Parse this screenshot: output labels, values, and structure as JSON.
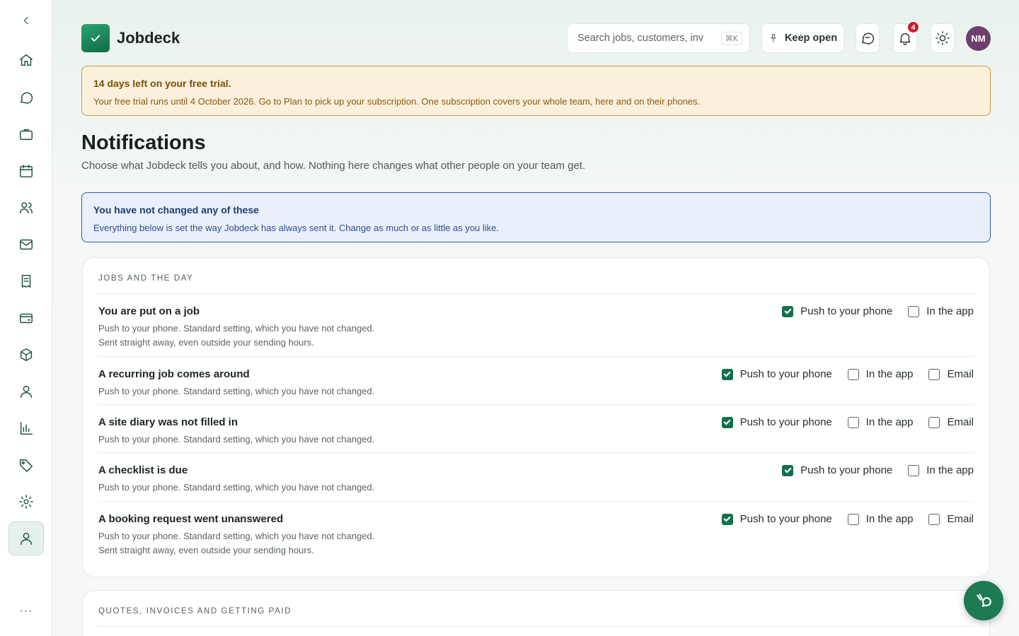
{
  "brand": {
    "name": "Jobdeck"
  },
  "search": {
    "placeholder": "Search jobs, customers, invoices",
    "shortcut": "⌘K"
  },
  "header": {
    "keep_open_label": "Keep open",
    "notification_count": "4",
    "avatar_initials": "NM"
  },
  "trial": {
    "title": "14 days left on your free trial.",
    "text": "Your free trial runs until 4 October 2026. Go to Plan to pick up your subscription. One subscription covers your whole team, here and on their phones."
  },
  "page": {
    "title": "Notifications",
    "subtitle": "Choose what Jobdeck tells you about, and how. Nothing here changes what other people on your team get."
  },
  "info": {
    "title": "You have not changed any of these",
    "text": "Everything below is set the way Jobdeck has always sent it. Change as much or as little as you like."
  },
  "sections": [
    {
      "heading": "JOBS AND THE DAY",
      "rows": [
        {
          "title": "You are put on a job",
          "desc1": "Push to your phone. Standard setting, which you have not changed.",
          "desc2": "Sent straight away, even outside your sending hours.",
          "options": [
            {
              "label": "Push to your phone",
              "checked": true
            },
            {
              "label": "In the app",
              "checked": false
            }
          ]
        },
        {
          "title": "A recurring job comes around",
          "desc1": "Push to your phone. Standard setting, which you have not changed.",
          "options": [
            {
              "label": "Push to your phone",
              "checked": true
            },
            {
              "label": "In the app",
              "checked": false
            },
            {
              "label": "Email",
              "checked": false
            }
          ]
        },
        {
          "title": "A site diary was not filled in",
          "desc1": "Push to your phone. Standard setting, which you have not changed.",
          "options": [
            {
              "label": "Push to your phone",
              "checked": true
            },
            {
              "label": "In the app",
              "checked": false
            },
            {
              "label": "Email",
              "checked": false
            }
          ]
        },
        {
          "title": "A checklist is due",
          "desc1": "Push to your phone. Standard setting, which you have not changed.",
          "options": [
            {
              "label": "Push to your phone",
              "checked": true
            },
            {
              "label": "In the app",
              "checked": false
            }
          ]
        },
        {
          "title": "A booking request went unanswered",
          "desc1": "Push to your phone. Standard setting, which you have not changed.",
          "desc2": "Sent straight away, even outside your sending hours.",
          "options": [
            {
              "label": "Push to your phone",
              "checked": true
            },
            {
              "label": "In the app",
              "checked": false
            },
            {
              "label": "Email",
              "checked": false
            }
          ]
        }
      ]
    },
    {
      "heading": "QUOTES, INVOICES AND GETTING PAID",
      "rows": []
    }
  ],
  "sidebar": {
    "items": [
      "home-icon",
      "chat-icon",
      "briefcase-icon",
      "calendar-icon",
      "team-icon",
      "mail-icon",
      "receipt-icon",
      "wallet-icon",
      "box-icon",
      "person-icon",
      "chart-icon",
      "tag-icon",
      "gear-icon",
      "profile-icon"
    ],
    "more": "···"
  }
}
